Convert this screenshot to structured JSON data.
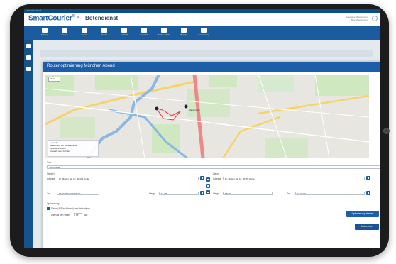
{
  "window": {
    "title": "SmartCourier®"
  },
  "header": {
    "logo": "SmartCourier",
    "logo_mark": "®",
    "app_name": "Botendienst",
    "user_line1": "Apotheke Mustermann",
    "user_line2": "Max Mustermann"
  },
  "toolbar": {
    "items": [
      {
        "label": "Fahrten",
        "icon": "truck-icon"
      },
      {
        "label": "Touren",
        "icon": "bag-icon"
      },
      {
        "label": "Export",
        "icon": "export-icon"
      },
      {
        "label": "Import",
        "icon": "import-icon"
      },
      {
        "label": "Statistik",
        "icon": "chart-icon"
      },
      {
        "label": "Lieferliste",
        "icon": "pin-icon"
      },
      {
        "label": "Status-Mails",
        "icon": "mail-icon"
      },
      {
        "label": "Belege",
        "icon": "receipt-icon"
      },
      {
        "label": "Auswertung",
        "icon": "search-icon"
      }
    ]
  },
  "dialog": {
    "title": "Routenoptimierung München Abend",
    "map": {
      "zoom": "10 km",
      "legend_title": "Legende",
      "legend_items": [
        "Markierung der Lieferadresse",
        "Optimierte Route",
        "Auswahl aller Fahrten"
      ],
      "pin_label": "Marienplatz"
    },
    "tour": {
      "label": "Tour",
      "value": "Tour Abend"
    },
    "start": {
      "label": "Startort",
      "address_label": "Adresse",
      "address": "Dr. Muster Str. 18, 80 345 Dorfe",
      "time_label": "Zeit",
      "time": "16:00 ABFAHRT 09:00",
      "length_label": "Länge",
      "length": "11,006"
    },
    "end": {
      "label": "Zielort",
      "address_label": "Adresse",
      "address": "Dr. Muster Str. 18, 80752 Dorfe",
      "time_label": "Länge",
      "time": "18:00",
      "return_label": "Zeit",
      "return": "17:47:00"
    },
    "optimize": {
      "label": "Optimierung",
      "checkbox_label": "Daten (& Rückfahrten) berücksichtigen",
      "interval_label": "Intervall der Route",
      "interval_value": "15",
      "interval_unit": "Min."
    },
    "buttons": {
      "optimize": "Optimierung starten",
      "cancel": "Abbrechen"
    }
  }
}
